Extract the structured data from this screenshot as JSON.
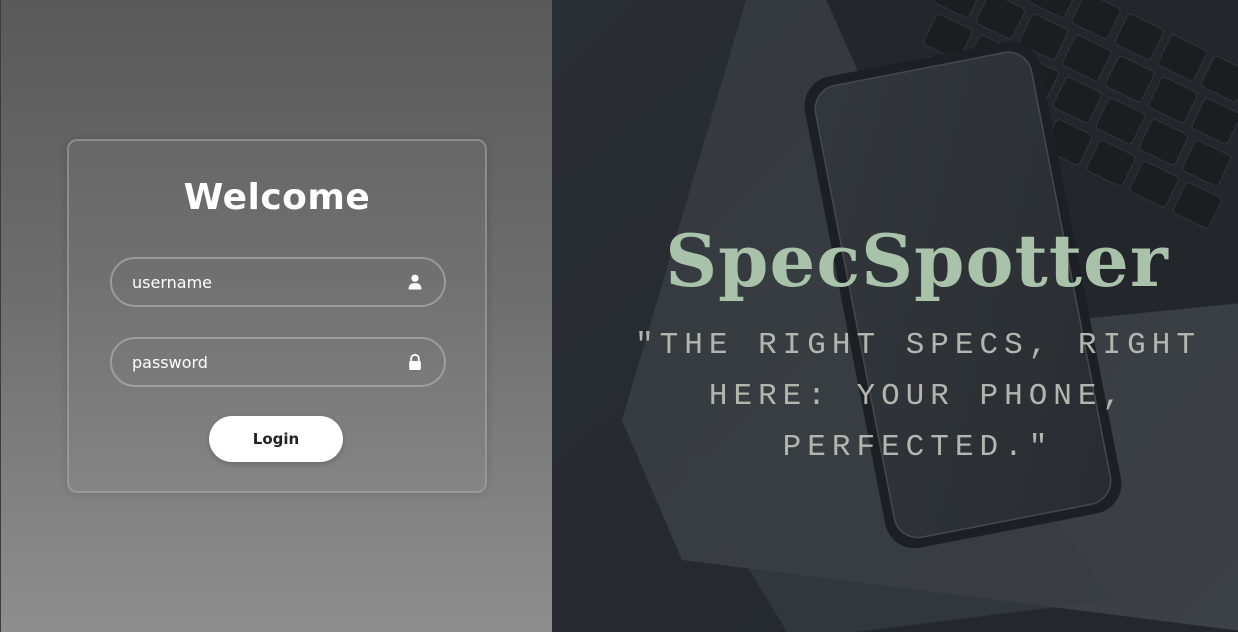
{
  "login": {
    "title": "Welcome",
    "username_placeholder": "username",
    "password_placeholder": "password",
    "login_label": "Login",
    "username_icon": "user-icon",
    "password_icon": "lock-icon"
  },
  "hero": {
    "brand": "SpecSpotter",
    "tagline": "\"THE RIGHT SPECS, RIGHT HERE: YOUR PHONE, PERFECTED.\"",
    "background_image": "laptop-and-phone-photo"
  },
  "colors": {
    "brand_text": "#a9c2aa",
    "tagline_text": "#b5b5b0",
    "button_bg": "#ffffff",
    "left_panel_top": "#595959",
    "left_panel_bottom": "#8e8e8e"
  }
}
